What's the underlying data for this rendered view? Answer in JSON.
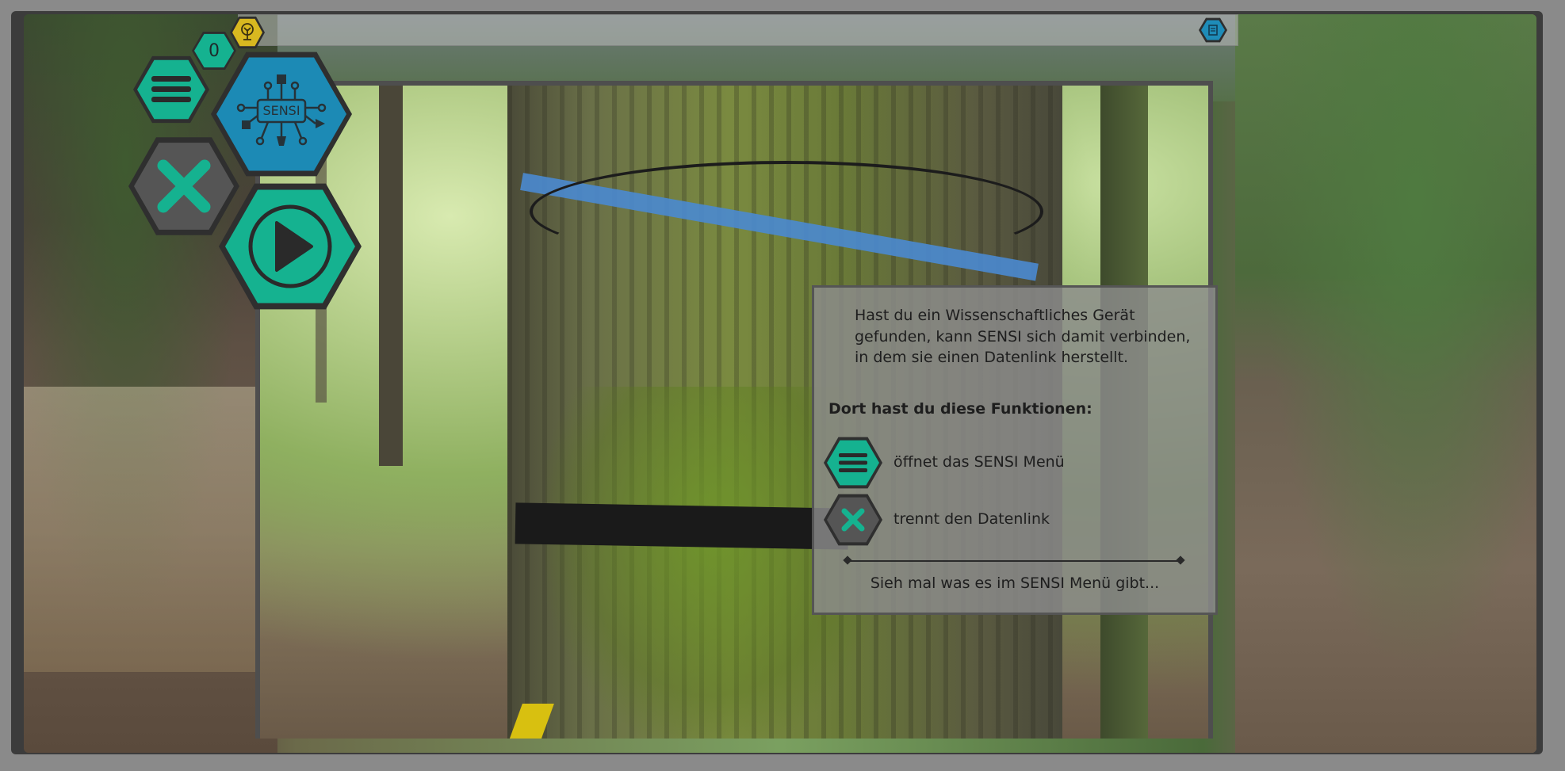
{
  "hud": {
    "counter_value": "0",
    "coin_icon": "tree-coin-icon",
    "doc_icon": "document-icon",
    "sensi_logo_text": "SENSI"
  },
  "dialog": {
    "intro": "Hast du ein Wissenschaftliches Gerät gefunden, kann SENSI sich damit verbinden, in dem sie einen Datenlink herstellt.",
    "heading": "Dort hast du diese Funktionen:",
    "functions": [
      {
        "icon": "menu-icon",
        "label": "öffnet das SENSI Menü"
      },
      {
        "icon": "close-icon",
        "label": "trennt den Datenlink"
      }
    ],
    "footer": "Sieh mal was es im SENSI Menü gibt..."
  },
  "colors": {
    "teal": "#15b290",
    "blue": "#1c8ab5",
    "gray": "#555555",
    "gold": "#d8b820"
  }
}
